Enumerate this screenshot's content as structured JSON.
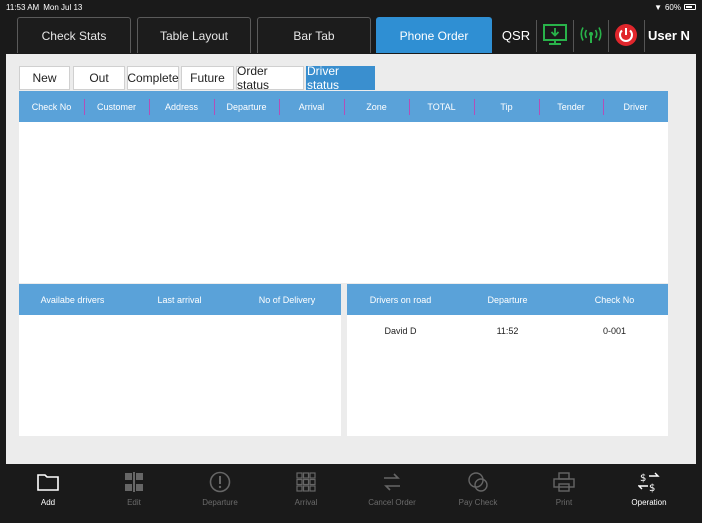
{
  "status": {
    "time": "11:53 AM",
    "date": "Mon Jul 13",
    "battery": "60%"
  },
  "top_tabs": [
    {
      "label": "Check Stats"
    },
    {
      "label": "Table Layout"
    },
    {
      "label": "Bar Tab"
    },
    {
      "label": "Phone Order"
    }
  ],
  "top_right": {
    "qsr": "QSR",
    "user": "User N"
  },
  "sub_tabs": [
    {
      "label": "New"
    },
    {
      "label": "Out"
    },
    {
      "label": "Complete"
    },
    {
      "label": "Future"
    },
    {
      "label": "Order status"
    },
    {
      "label": "Driver status"
    }
  ],
  "orders_table": {
    "columns": [
      "Check No",
      "Customer",
      "Address",
      "Departure",
      "Arrival",
      "Zone",
      "TOTAL",
      "Tip",
      "Tender",
      "Driver"
    ]
  },
  "available_table": {
    "columns": [
      "Availabe drivers",
      "Last arrival",
      "No of Delivery"
    ]
  },
  "road_table": {
    "columns": [
      "Drivers on road",
      "Departure",
      "Check No"
    ],
    "rows": [
      {
        "driver": "David D",
        "departure": "11:52",
        "check_no": "0-001"
      }
    ]
  },
  "toolbar": [
    {
      "label": "Add",
      "icon": "folder-icon",
      "enabled": true
    },
    {
      "label": "Edit",
      "icon": "edit-grid-icon",
      "enabled": false
    },
    {
      "label": "Departure",
      "icon": "exclamation-icon",
      "enabled": false
    },
    {
      "label": "Arrival",
      "icon": "grid-icon",
      "enabled": false
    },
    {
      "label": "Cancel Order",
      "icon": "swap-arrows-icon",
      "enabled": false
    },
    {
      "label": "Pay Check",
      "icon": "coins-icon",
      "enabled": false
    },
    {
      "label": "Print",
      "icon": "printer-icon",
      "enabled": false
    },
    {
      "label": "Operation",
      "icon": "dollar-swap-icon",
      "enabled": true
    }
  ],
  "colors": {
    "active_tab": "#2f8fd3",
    "header": "#5aa2d9",
    "divider": "#b24fb8",
    "monitor_icon": "#29b34a",
    "signal_icon": "#29b34a",
    "power_icon": "#e0262c"
  }
}
